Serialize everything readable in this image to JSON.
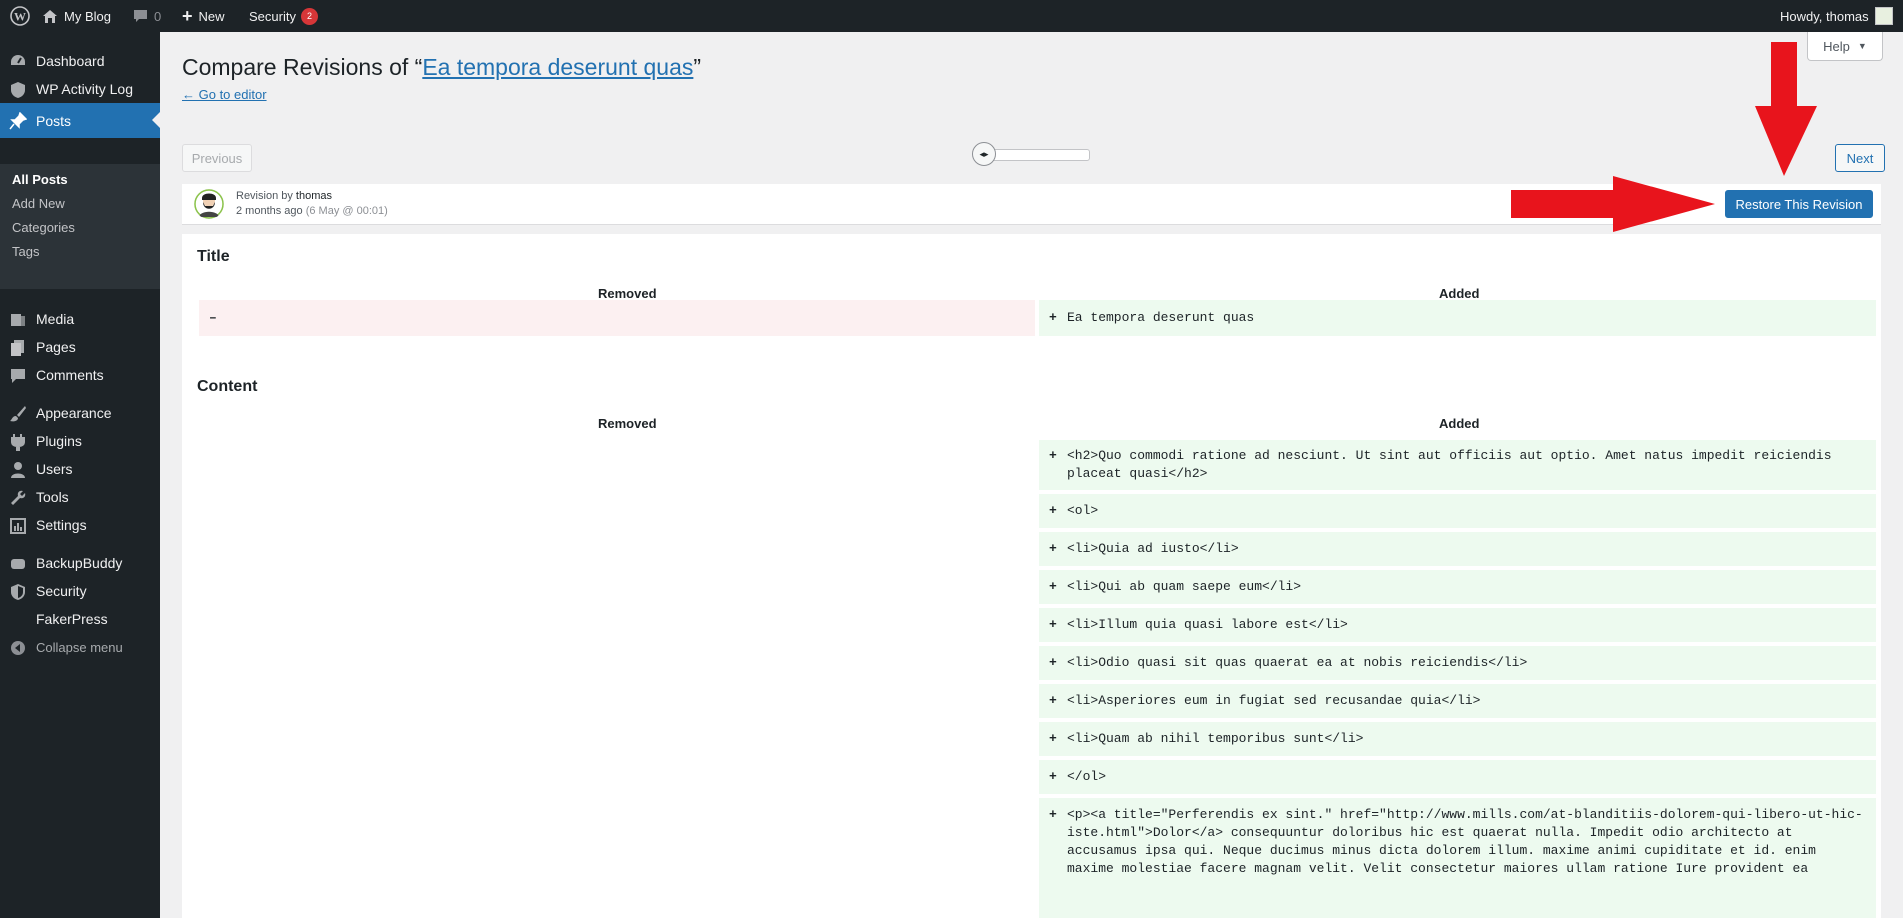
{
  "admin_bar": {
    "site_name": "My Blog",
    "comments_count": "0",
    "new_label": "New",
    "security_label": "Security",
    "security_badge": "2",
    "greeting": "Howdy, thomas"
  },
  "sidebar": {
    "items": [
      {
        "label": "Dashboard",
        "icon": "dashboard-icon"
      },
      {
        "label": "WP Activity Log",
        "icon": "activity-log-icon"
      },
      {
        "label": "Posts",
        "icon": "pin-icon"
      },
      {
        "label": "Media",
        "icon": "media-icon"
      },
      {
        "label": "Pages",
        "icon": "pages-icon"
      },
      {
        "label": "Comments",
        "icon": "comments-icon"
      },
      {
        "label": "Appearance",
        "icon": "brush-icon"
      },
      {
        "label": "Plugins",
        "icon": "plugin-icon"
      },
      {
        "label": "Users",
        "icon": "user-icon"
      },
      {
        "label": "Tools",
        "icon": "wrench-icon"
      },
      {
        "label": "Settings",
        "icon": "settings-icon"
      },
      {
        "label": "BackupBuddy",
        "icon": "backup-icon"
      },
      {
        "label": "Security",
        "icon": "shield-icon"
      },
      {
        "label": "FakerPress",
        "icon": ""
      },
      {
        "label": "Collapse menu",
        "icon": "collapse-icon"
      }
    ],
    "posts_submenu": [
      "All Posts",
      "Add New",
      "Categories",
      "Tags"
    ]
  },
  "header": {
    "title_prefix": "Compare Revisions of “",
    "title_link": "Ea tempora deserunt quas",
    "title_suffix": "”",
    "back_link": "← Go to editor",
    "help_label": "Help"
  },
  "nav": {
    "previous": "Previous",
    "next": "Next",
    "slider_position": 0.0
  },
  "revision": {
    "by_prefix": "Revision by",
    "author": "thomas",
    "ago": "2 months ago",
    "date": "(6 May @ 00:01)",
    "restore_label": "Restore This Revision"
  },
  "diff": {
    "title_section": "Title",
    "content_section": "Content",
    "removed_label": "Removed",
    "added_label": "Added",
    "title_removed_sign": "–",
    "title_added": "Ea tempora deserunt quas",
    "content_added": [
      "<h2>Quo commodi ratione ad nesciunt. Ut sint aut officiis aut optio. Amet natus impedit reiciendis placeat quasi</h2>",
      "<ol>",
      "<li>Quia ad iusto</li>",
      "<li>Qui ab quam saepe eum</li>",
      "<li>Illum quia quasi labore est</li>",
      "<li>Odio quasi sit quas quaerat ea at nobis reiciendis</li>",
      "<li>Asperiores eum in fugiat sed recusandae quia</li>",
      "<li>Quam ab nihil temporibus sunt</li>",
      "</ol>",
      "<p><a title=\"Perferendis ex sint.\" href=\"http://www.mills.com/at-blanditiis-dolorem-qui-libero-ut-hic-iste.html\">Dolor</a> consequuntur doloribus hic est quaerat nulla. Impedit odio architecto at accusamus ipsa qui. Neque ducimus minus dicta dolorem illum. maxime animi cupiditate et id. enim maxime molestiae facere magnam velit. Velit consectetur maiores ullam ratione Iure provident ea"
    ]
  },
  "colors": {
    "admin_dark": "#1d2327",
    "accent_blue": "#2271b1",
    "removed_bg": "#fcf0f1",
    "added_bg": "#edfaef",
    "annotation_red": "#e8141c"
  }
}
